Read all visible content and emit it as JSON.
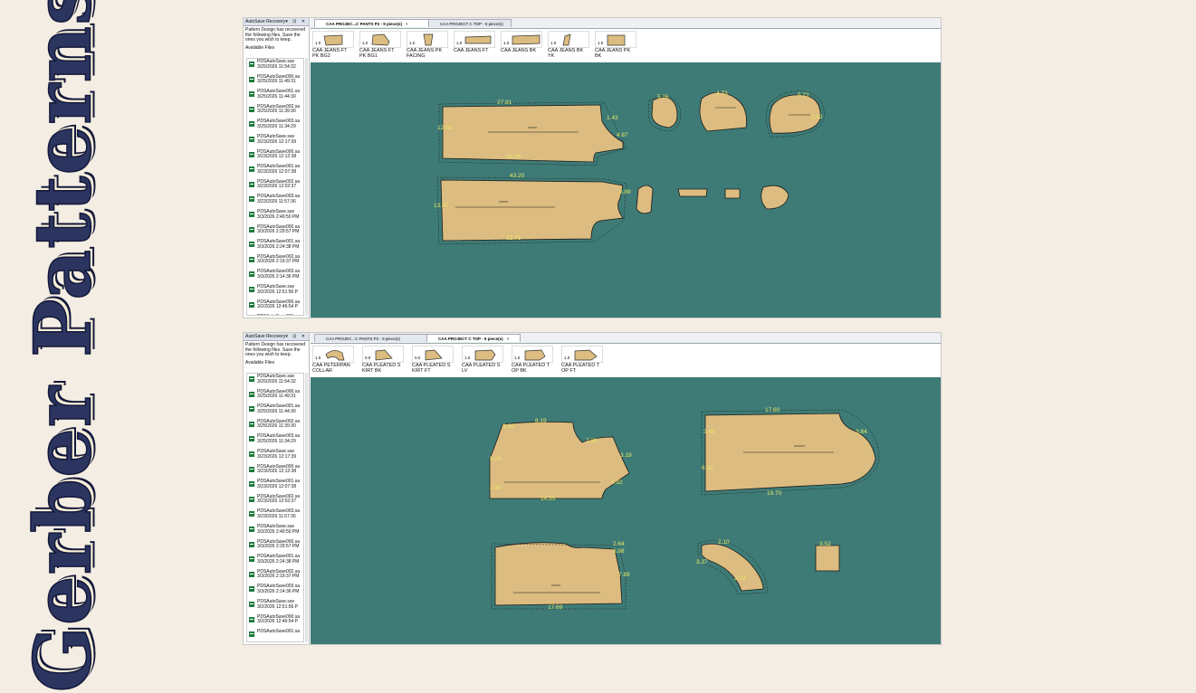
{
  "slide_title": "Gerber Patterns",
  "colors": {
    "background": "#f3ede3",
    "title": "#2b3560",
    "canvas": "#3e7b76",
    "piece_fill": "#dcbc80",
    "measure_text": "#e8e86a"
  },
  "autosave_panel": {
    "title": "AutoSave Recovery",
    "controls": "▾ ⊡ ✕",
    "message": "Pattern Design has recovered the following files. Save the ones you wish to keep.",
    "available_label": "Available Files",
    "files": [
      {
        "name": "PDSAutoSave.sav",
        "date": "3/25/2026 11:54:32"
      },
      {
        "name": "PDSAutoSave000.sa",
        "date": "3/25/2026 11:49:31"
      },
      {
        "name": "PDSAutoSave001.sa",
        "date": "3/25/2026 11:44:30"
      },
      {
        "name": "PDSAutoSave002.sa",
        "date": "3/25/2026 11:39:30"
      },
      {
        "name": "PDSAutoSave003.sa",
        "date": "3/25/2026 11:34:29"
      },
      {
        "name": "PDSAutoSave.sav",
        "date": "3/23/2026 12:17:39"
      },
      {
        "name": "PDSAutoSave000.sa",
        "date": "3/23/2026 12:12:38"
      },
      {
        "name": "PDSAutoSave001.sa",
        "date": "3/23/2026 12:07:38"
      },
      {
        "name": "PDSAutoSave002.sa",
        "date": "3/23/2026 12:02:37"
      },
      {
        "name": "PDSAutoSave003.sa",
        "date": "3/23/2026 11:57:36"
      },
      {
        "name": "PDSAutoSave.sav",
        "date": "3/3/2026 2:49:50 PM"
      },
      {
        "name": "PDSAutoSave000.sa",
        "date": "3/3/2026 2:29:57 PM"
      },
      {
        "name": "PDSAutoSave001.sa",
        "date": "3/3/2026 2:24:38 PM"
      },
      {
        "name": "PDSAutoSave002.sa",
        "date": "3/3/2026 2:19:37 PM"
      },
      {
        "name": "PDSAutoSave003.sa",
        "date": "3/3/2026 2:14:36 PM"
      },
      {
        "name": "PDSAutoSave.sav",
        "date": "3/2/2026 12:51:56 P"
      },
      {
        "name": "PDSAutoSave000.sa",
        "date": "3/2/2026 12:46:54 P"
      },
      {
        "name": "PDSAutoSave001.sa",
        "date": ""
      }
    ]
  },
  "window_top": {
    "tabs": [
      {
        "label": "CAA PROJEC...C PANTS P2 - 9 piece(s)",
        "active": true,
        "close": "×"
      },
      {
        "label": "CAA PROJECT C TOP - 5 piece(s)",
        "active": false,
        "close": ""
      }
    ],
    "pieces": [
      {
        "qty": "1.0",
        "name": "CAA JEANS FT PK BG2"
      },
      {
        "qty": "1.0",
        "name": "CAA JEANS FT PK BG1"
      },
      {
        "qty": "1.0",
        "name": "CAA JEANS PK FACING"
      },
      {
        "qty": "1.0",
        "name": "CAA JEANS FT"
      },
      {
        "qty": "1.0",
        "name": "CAA JEANS BK"
      },
      {
        "qty": "1.0",
        "name": "CAA JEANS BK YK"
      },
      {
        "qty": "1.0",
        "name": "CAA JEANS PK BK"
      }
    ],
    "measurements": [
      "27.81",
      "12.08",
      "1.43",
      "4.87",
      "33.96",
      "43.20",
      "13.47",
      "32.75",
      "3.89",
      "5.26",
      "4.73",
      "5.72",
      "3.62"
    ]
  },
  "window_bottom": {
    "tabs": [
      {
        "label": "CAA PROJEC...C PANTS P2 - 9 piece(s)",
        "active": false,
        "close": ""
      },
      {
        "label": "CAA PROJECT C TOP - 5 piece(s)",
        "active": true,
        "close": "×"
      }
    ],
    "pieces": [
      {
        "qty": "1.0",
        "name": "CAA PETERPAN COLLAR"
      },
      {
        "qty": "0.0",
        "name": "CAA PLEATED S KIRT BK"
      },
      {
        "qty": "0.0",
        "name": "CAA PLEATED S KIRT FT"
      },
      {
        "qty": "1.0",
        "name": "CAA PLEATED S LV"
      },
      {
        "qty": "1.0",
        "name": "CAA PLEATED T OP BK"
      },
      {
        "qty": "1.0",
        "name": "CAA PLEATED T OP FT"
      }
    ],
    "measurements": [
      "8.19",
      "3.38",
      "7.39",
      "3.19",
      "5.24",
      "2.90",
      "14.35",
      "1.92",
      "17.60",
      "3.84",
      "3.48",
      "6.42",
      "19.70",
      "2.64",
      "3.88",
      "7.89",
      "17.69",
      "2.10",
      "3.37",
      "2.53",
      "3.52"
    ]
  }
}
